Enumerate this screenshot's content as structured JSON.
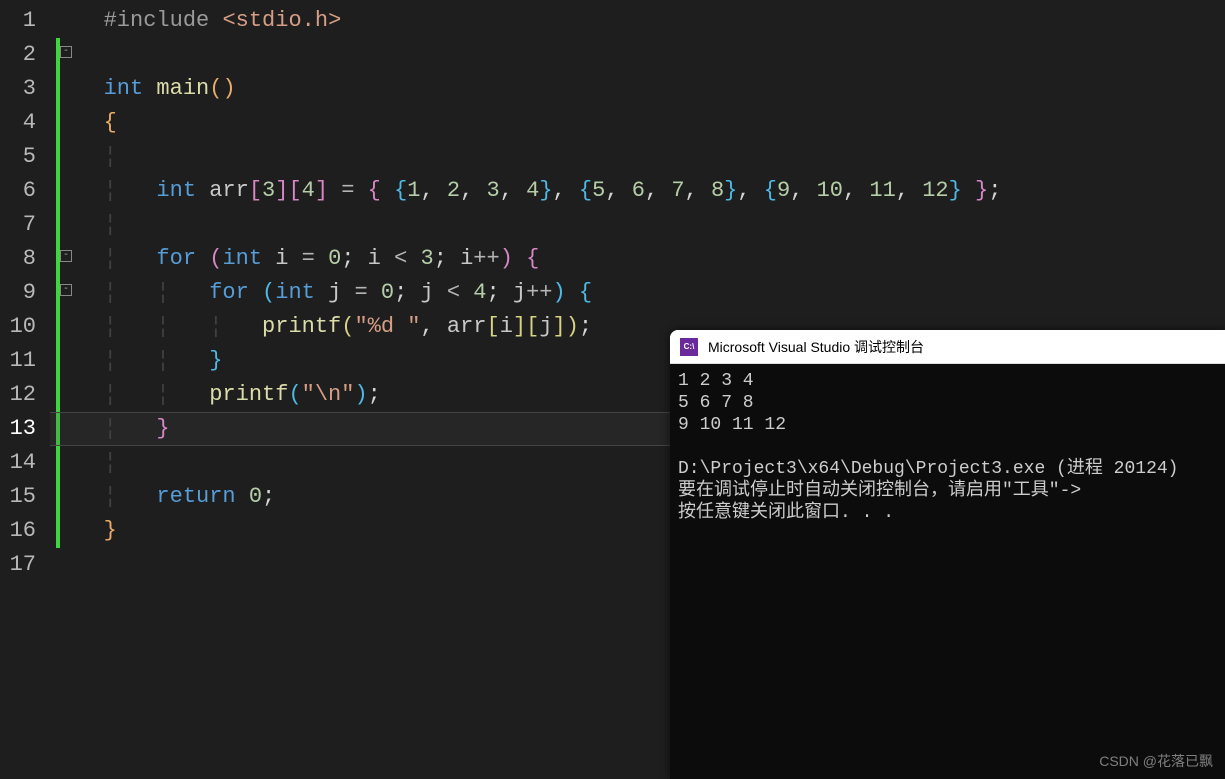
{
  "lineNumbers": [
    "1",
    "2",
    "3",
    "4",
    "5",
    "6",
    "7",
    "8",
    "9",
    "10",
    "11",
    "12",
    "13",
    "14",
    "15",
    "16",
    "17"
  ],
  "currentLine": 13,
  "code": {
    "l1": {
      "include": "#include",
      "lt": "<",
      "header": "stdio.h",
      "gt": ">"
    },
    "l3": {
      "kw_int": "int",
      "main": "main",
      "op": "(",
      "cp": ")"
    },
    "l4": "{",
    "l6": {
      "kw_int": "int",
      "arr": "arr",
      "d1": "3",
      "d2": "4",
      "eq": "=",
      "nums": [
        "1",
        "2",
        "3",
        "4",
        "5",
        "6",
        "7",
        "8",
        "9",
        "10",
        "11",
        "12"
      ],
      "semi": ";"
    },
    "l8": {
      "kw_for": "for",
      "kw_int": "int",
      "i": "i",
      "zero": "0",
      "lt": "<",
      "three": "3",
      "inc": "++"
    },
    "l9": {
      "kw_for": "for",
      "kw_int": "int",
      "j": "j",
      "zero": "0",
      "lt": "<",
      "four": "4",
      "inc": "++"
    },
    "l10": {
      "printf": "printf",
      "fmt": "\"%d \"",
      "arr": "arr",
      "i": "i",
      "j": "j"
    },
    "l11": "}",
    "l12": {
      "printf": "printf",
      "nl": "\"\\n\""
    },
    "l13": "}",
    "l15": {
      "kw_return": "return",
      "zero": "0"
    },
    "l16": "}"
  },
  "console": {
    "title": "Microsoft Visual Studio 调试控制台",
    "output": [
      "1 2 3 4",
      "5 6 7 8",
      "9 10 11 12"
    ],
    "path_line": "D:\\Project3\\x64\\Debug\\Project3.exe (进程 20124)",
    "hint_line": "要在调试停止时自动关闭控制台，请启用\"工具\"->",
    "close_line": "按任意键关闭此窗口. . ."
  },
  "watermark": "CSDN @花落已飘"
}
